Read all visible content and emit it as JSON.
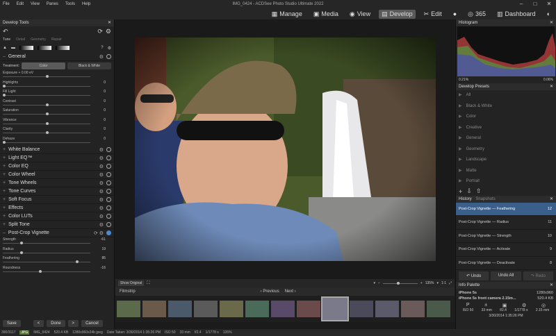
{
  "menu": [
    "File",
    "Edit",
    "View",
    "Panes",
    "Tools",
    "Help"
  ],
  "app_title": "IMG_0424 - ACDSee Photo Studio Ultimate 2022",
  "modes": [
    {
      "icon": "manage-icon",
      "glyph": "▦",
      "label": "Manage"
    },
    {
      "icon": "media-icon",
      "glyph": "▣",
      "label": "Media"
    },
    {
      "icon": "view-icon",
      "glyph": "◉",
      "label": "View"
    },
    {
      "icon": "develop-icon",
      "glyph": "▤",
      "label": "Develop"
    },
    {
      "icon": "edit-icon",
      "glyph": "✂",
      "label": "Edit"
    },
    {
      "icon": "globe-icon",
      "glyph": "●",
      "label": ""
    },
    {
      "icon": "365-icon",
      "glyph": "◎",
      "label": "365"
    },
    {
      "icon": "dashboard-icon",
      "glyph": "▥",
      "label": "Dashboard"
    },
    {
      "icon": "connect-icon",
      "glyph": "◐",
      "label": ""
    }
  ],
  "left": {
    "title": "Develop Tools",
    "tabs": [
      "Tune",
      "Detail",
      "Geometry",
      "Repair"
    ],
    "general": "General",
    "treatment_label": "Treatment:",
    "treatment_options": [
      "Color",
      "Black & White"
    ],
    "sliders": [
      {
        "label": "Exposure + 0.00 eV",
        "value": "",
        "pct": 0.5
      },
      {
        "label": "Highlights",
        "value": "0",
        "pct": 0.0
      },
      {
        "label": "Fill Light",
        "value": "0",
        "pct": 0.0
      },
      {
        "label": "Contrast",
        "value": "0",
        "pct": 0.5
      },
      {
        "label": "Saturation",
        "value": "0",
        "pct": 0.5
      },
      {
        "label": "Vibrance",
        "value": "0",
        "pct": 0.5
      },
      {
        "label": "Clarity",
        "value": "0",
        "pct": 0.5
      },
      {
        "label": "Dehaze",
        "value": "0",
        "pct": 0.0
      }
    ],
    "sections": [
      "White Balance",
      "Light EQ™",
      "Color EQ",
      "Color Wheel",
      "Tone Wheels",
      "Tone Curves",
      "Soft Focus",
      "Effects",
      "Color LUTs",
      "Split Tone"
    ],
    "vignette_title": "Post-Crop Vignette",
    "vignette_sliders": [
      {
        "label": "Strength",
        "value": "-61",
        "pct": 0.2
      },
      {
        "label": "Radius",
        "value": "19",
        "pct": 0.2
      },
      {
        "label": "Feathering",
        "value": "85",
        "pct": 0.85
      },
      {
        "label": "Roundness",
        "value": "-16",
        "pct": 0.42
      }
    ],
    "buttons": {
      "save": "Save",
      "done": "Done",
      "cancel": "Cancel"
    }
  },
  "viewbar": {
    "show_original": "Show Original",
    "zoom": "135%",
    "ratio": "1:1"
  },
  "filmstrip": {
    "label": "Filmstrip",
    "previous": "Previous",
    "next": "Next",
    "thumb_count": 13,
    "selected_index": 8
  },
  "status": {
    "counter": "390/3117",
    "format": "JPG",
    "filename": "IMG_0424",
    "size": "520.4 KB",
    "dims": "1280x960x24b jpeg",
    "date": "Date Taken: 3/30/2014 1:35:26 PM",
    "iso": "ISO 50",
    "focal": "33 mm",
    "aperture": "f/2.4",
    "shutter": "1/1778 s",
    "zoom": "135%"
  },
  "right": {
    "histogram_title": "Histogram",
    "hist_left": "0.21%",
    "hist_right": "0.06%",
    "presets_title": "Develop Presets",
    "presets": [
      "All",
      "Black & White",
      "Color",
      "Creative",
      "General",
      "Geometry",
      "Landscape",
      "Matte",
      "Portrait"
    ],
    "history_tab": "History",
    "snapshots_tab": "Snapshots",
    "history": [
      {
        "label": "Post-Crop Vignette — Feathering",
        "n": "12"
      },
      {
        "label": "Post-Crop Vignette — Radius",
        "n": "11"
      },
      {
        "label": "Post-Crop Vignette — Strength",
        "n": "10"
      },
      {
        "label": "Post-Crop Vignette — Activate",
        "n": "9"
      },
      {
        "label": "Post-Crop Vignette — Deactivate",
        "n": "8"
      }
    ],
    "undo": "Undo",
    "undo_all": "Undo All",
    "redo": "Redo",
    "info_title": "Info Palette",
    "camera": "iPhone 5s",
    "lens": "iPhone 5s front camera 2.15m...",
    "res": "1280x960",
    "filesize": "520.4 KB",
    "exif_vals": [
      "ISO 50",
      "33 mm",
      "f/2.4",
      "1/1778 s",
      "2.15 mm"
    ],
    "exif_icons": [
      "P",
      "±",
      "▣",
      "⚙",
      "◎"
    ],
    "date": "3/30/2014 1:35:26 PM"
  }
}
